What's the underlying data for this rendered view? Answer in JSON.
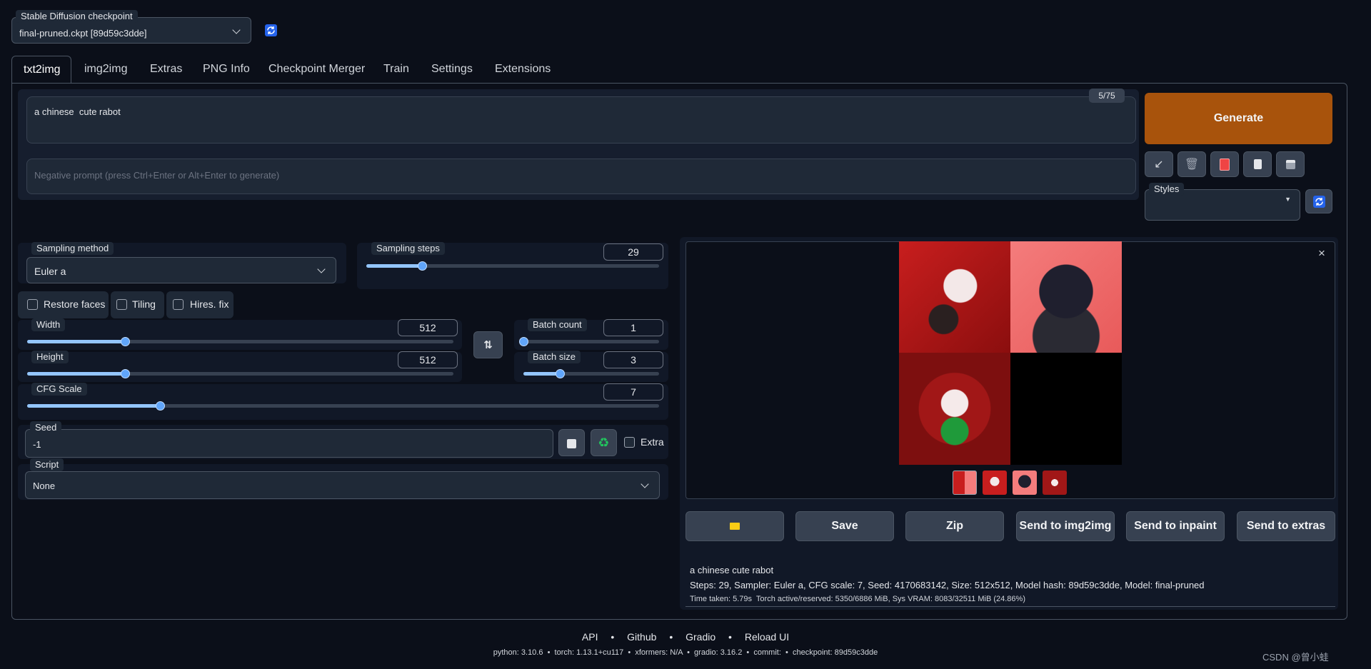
{
  "checkpoint": {
    "label": "Stable Diffusion checkpoint",
    "value": "final-pruned.ckpt [89d59c3dde]"
  },
  "tabs": [
    {
      "label": "txt2img"
    },
    {
      "label": "img2img"
    },
    {
      "label": "Extras"
    },
    {
      "label": "PNG Info"
    },
    {
      "label": "Checkpoint Merger"
    },
    {
      "label": "Train"
    },
    {
      "label": "Settings"
    },
    {
      "label": "Extensions"
    }
  ],
  "prompt": {
    "value": "a chinese  cute rabot",
    "token_count": "5/75"
  },
  "negative_prompt": {
    "placeholder": "Negative prompt (press Ctrl+Enter or Alt+Enter to generate)"
  },
  "generate": {
    "label": "Generate"
  },
  "styles": {
    "label": "Styles",
    "value": ""
  },
  "sampling": {
    "method_label": "Sampling method",
    "method_value": "Euler a",
    "steps_label": "Sampling steps",
    "steps_value": "29",
    "steps_fraction": 0.19
  },
  "checkboxes": {
    "restore_faces": "Restore faces",
    "tiling": "Tiling",
    "hires_fix": "Hires. fix"
  },
  "width": {
    "label": "Width",
    "value": "512",
    "fraction": 0.23
  },
  "height": {
    "label": "Height",
    "value": "512",
    "fraction": 0.23
  },
  "batch_count": {
    "label": "Batch count",
    "value": "1",
    "fraction": 0
  },
  "batch_size": {
    "label": "Batch size",
    "value": "3",
    "fraction": 0.27
  },
  "cfg": {
    "label": "CFG Scale",
    "value": "7",
    "fraction": 0.21
  },
  "seed": {
    "label": "Seed",
    "value": "-1",
    "extra_label": "Extra"
  },
  "script": {
    "label": "Script",
    "value": "None"
  },
  "output_buttons": {
    "folder_icon": "folder-icon",
    "save": "Save",
    "zip": "Zip",
    "send_img2img": "Send to img2img",
    "send_inpaint": "Send to inpaint",
    "send_extras": "Send to extras"
  },
  "info": {
    "prompt": "a chinese cute rabot",
    "params": "Steps: 29, Sampler: Euler a, CFG scale: 7, Seed: 4170683142, Size: 512x512, Model hash: 89d59c3dde, Model: final-pruned",
    "timing": "Time taken: 5.79s  Torch active/reserved: 5350/6886 MiB, Sys VRAM: 8083/32511 MiB (24.86%)"
  },
  "footer": {
    "links": [
      "API",
      "Github",
      "Gradio",
      "Reload UI"
    ],
    "versions": "python: 3.10.6  •  torch: 1.13.1+cu117  •  xformers: N/A  •  gradio: 3.16.2  •  commit:  •  checkpoint: 89d59c3dde"
  },
  "watermark": "CSDN @曾小蛙",
  "colors": {
    "generate_bg": "#a8530c",
    "accent_blue": "#3b82f6",
    "background": "#0b0f19"
  }
}
